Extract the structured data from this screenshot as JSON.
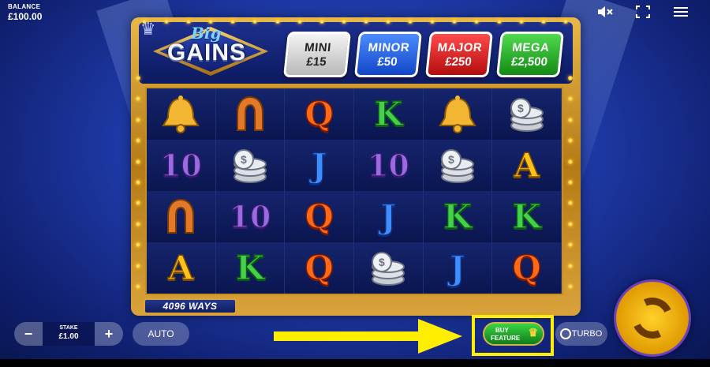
{
  "balance": {
    "label": "BALANCE",
    "value": "£100.00"
  },
  "top_icons": [
    "mute-icon",
    "fullscreen-icon",
    "menu-icon"
  ],
  "logo": {
    "line1": "Big",
    "line2": "GAINS"
  },
  "jackpots": [
    {
      "name": "MINI",
      "value": "£15",
      "color": "#c8c8c8"
    },
    {
      "name": "MINOR",
      "value": "£50",
      "color": "#2060e0"
    },
    {
      "name": "MAJOR",
      "value": "£250",
      "color": "#d01818"
    },
    {
      "name": "MEGA",
      "value": "£2,500",
      "color": "#20a020"
    }
  ],
  "reels": [
    [
      "bell",
      "10",
      "horseshoe",
      "A"
    ],
    [
      "horseshoe",
      "coins",
      "10",
      "K"
    ],
    [
      "Q",
      "J",
      "Q",
      "Q"
    ],
    [
      "K",
      "10",
      "J",
      "coins"
    ],
    [
      "bell",
      "coins",
      "K",
      "J"
    ],
    [
      "coins",
      "A",
      "K",
      "Q"
    ]
  ],
  "ways_label": "4096 WAYS",
  "stake": {
    "label": "STAKE",
    "value": "£1.00",
    "minus": "−",
    "plus": "+"
  },
  "auto_label": "AUTO",
  "buy_feature": {
    "line1": "BUY",
    "line2": "FEATURE"
  },
  "turbo_label": "TURBO",
  "accent": {
    "highlight": "#ffee00",
    "spin": "#ffc21a"
  }
}
